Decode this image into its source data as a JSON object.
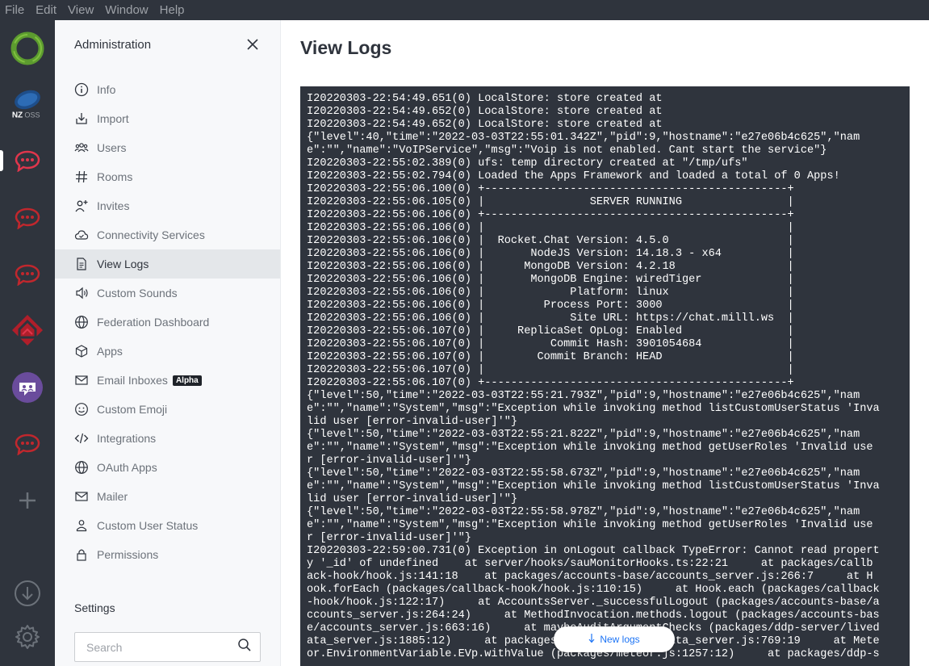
{
  "menubar": {
    "items": [
      "File",
      "Edit",
      "View",
      "Window",
      "Help"
    ]
  },
  "sidebar": {
    "title": "Administration",
    "items": [
      {
        "label": "Info",
        "icon": "info-icon"
      },
      {
        "label": "Import",
        "icon": "import-icon"
      },
      {
        "label": "Users",
        "icon": "users-icon"
      },
      {
        "label": "Rooms",
        "icon": "hashtag-icon"
      },
      {
        "label": "Invites",
        "icon": "user-plus-icon"
      },
      {
        "label": "Connectivity Services",
        "icon": "cloud-icon"
      },
      {
        "label": "View Logs",
        "icon": "document-icon",
        "active": true
      },
      {
        "label": "Custom Sounds",
        "icon": "speaker-icon"
      },
      {
        "label": "Federation Dashboard",
        "icon": "globe-icon"
      },
      {
        "label": "Apps",
        "icon": "cube-icon"
      },
      {
        "label": "Email Inboxes",
        "icon": "mail-icon",
        "badge": "Alpha"
      },
      {
        "label": "Custom Emoji",
        "icon": "emoji-icon"
      },
      {
        "label": "Integrations",
        "icon": "code-icon"
      },
      {
        "label": "OAuth Apps",
        "icon": "globe-icon"
      },
      {
        "label": "Mailer",
        "icon": "mail-icon"
      },
      {
        "label": "Custom User Status",
        "icon": "user-icon"
      },
      {
        "label": "Permissions",
        "icon": "lock-icon"
      }
    ],
    "settings_label": "Settings",
    "search_placeholder": "Search"
  },
  "main": {
    "title": "View Logs",
    "new_logs_label": "New logs",
    "log_lines": [
      "I20220303-22:54:49.651(0) LocalStore: store created at",
      "I20220303-22:54:49.652(0) LocalStore: store created at",
      "I20220303-22:54:49.652(0) LocalStore: store created at",
      "{\"level\":40,\"time\":\"2022-03-03T22:55:01.342Z\",\"pid\":9,\"hostname\":\"e27e06b4c625\",\"nam",
      "e\":\"\",\"name\":\"VoIPService\",\"msg\":\"Voip is not enabled. Cant start the service\"}",
      "I20220303-22:55:02.389(0) ufs: temp directory created at \"/tmp/ufs\"",
      "I20220303-22:55:02.794(0) Loaded the Apps Framework and loaded a total of 0 Apps!",
      "I20220303-22:55:06.100(0) +----------------------------------------------+",
      "I20220303-22:55:06.105(0) |                SERVER RUNNING                |",
      "I20220303-22:55:06.106(0) +----------------------------------------------+",
      "I20220303-22:55:06.106(0) |                                              |",
      "I20220303-22:55:06.106(0) |  Rocket.Chat Version: 4.5.0                  |",
      "I20220303-22:55:06.106(0) |       NodeJS Version: 14.18.3 - x64          |",
      "I20220303-22:55:06.106(0) |      MongoDB Version: 4.2.18                 |",
      "I20220303-22:55:06.106(0) |       MongoDB Engine: wiredTiger             |",
      "I20220303-22:55:06.106(0) |             Platform: linux                  |",
      "I20220303-22:55:06.106(0) |         Process Port: 3000                   |",
      "I20220303-22:55:06.106(0) |             Site URL: https://chat.milll.ws  |",
      "I20220303-22:55:06.107(0) |     ReplicaSet OpLog: Enabled                |",
      "I20220303-22:55:06.107(0) |          Commit Hash: 3901054684             |",
      "I20220303-22:55:06.107(0) |        Commit Branch: HEAD                   |",
      "I20220303-22:55:06.107(0) |                                              |",
      "I20220303-22:55:06.107(0) +----------------------------------------------+",
      "{\"level\":50,\"time\":\"2022-03-03T22:55:21.793Z\",\"pid\":9,\"hostname\":\"e27e06b4c625\",\"nam",
      "e\":\"\",\"name\":\"System\",\"msg\":\"Exception while invoking method listCustomUserStatus 'Inva",
      "lid user [error-invalid-user]'\"}",
      "{\"level\":50,\"time\":\"2022-03-03T22:55:21.822Z\",\"pid\":9,\"hostname\":\"e27e06b4c625\",\"nam",
      "e\":\"\",\"name\":\"System\",\"msg\":\"Exception while invoking method getUserRoles 'Invalid use",
      "r [error-invalid-user]'\"}",
      "{\"level\":50,\"time\":\"2022-03-03T22:55:58.673Z\",\"pid\":9,\"hostname\":\"e27e06b4c625\",\"nam",
      "e\":\"\",\"name\":\"System\",\"msg\":\"Exception while invoking method listCustomUserStatus 'Inva",
      "lid user [error-invalid-user]'\"}",
      "{\"level\":50,\"time\":\"2022-03-03T22:55:58.978Z\",\"pid\":9,\"hostname\":\"e27e06b4c625\",\"nam",
      "e\":\"\",\"name\":\"System\",\"msg\":\"Exception while invoking method getUserRoles 'Invalid use",
      "r [error-invalid-user]'\"}",
      "I20220303-22:59:00.731(0) Exception in onLogout callback TypeError: Cannot read propert",
      "y '_id' of undefined    at server/hooks/sauMonitorHooks.ts:22:21     at packages/callb",
      "ack-hook/hook.js:141:18    at packages/accounts-base/accounts_server.js:266:7     at H",
      "ook.forEach (packages/callback-hook/hook.js:110:15)     at Hook.each (packages/callback",
      "-hook/hook.js:122:17)     at AccountsServer._successfulLogout (packages/accounts-base/a",
      "ccounts_server.js:264:24)     at MethodInvocation.methods.logout (packages/accounts-bas",
      "e/accounts_server.js:663:16)     at maybeAuditArgumentChecks (packages/ddp-server/lived",
      "ata_server.js:1885:12)     at packages/ddp-server/livedata_server.js:769:19     at Mete",
      "or.EnvironmentVariable.EVp.withValue (packages/meteor.js:1257:12)     at packages/ddp-s"
    ]
  },
  "rail": {
    "items": [
      "workspace-ring-icon",
      "nzoss-icon",
      "rocketchat-icon",
      "rocketchat-icon",
      "rocketchat-icon",
      "house-logo-icon",
      "group-chat-icon",
      "rocketchat-icon",
      "add-server-icon",
      "download-icon",
      "settings-gear-icon"
    ]
  },
  "colors": {
    "rail_bg": "#2f343d",
    "accent_red": "#e0364c",
    "link_blue": "#1d74f5",
    "active_item": "#e4e7ea"
  }
}
